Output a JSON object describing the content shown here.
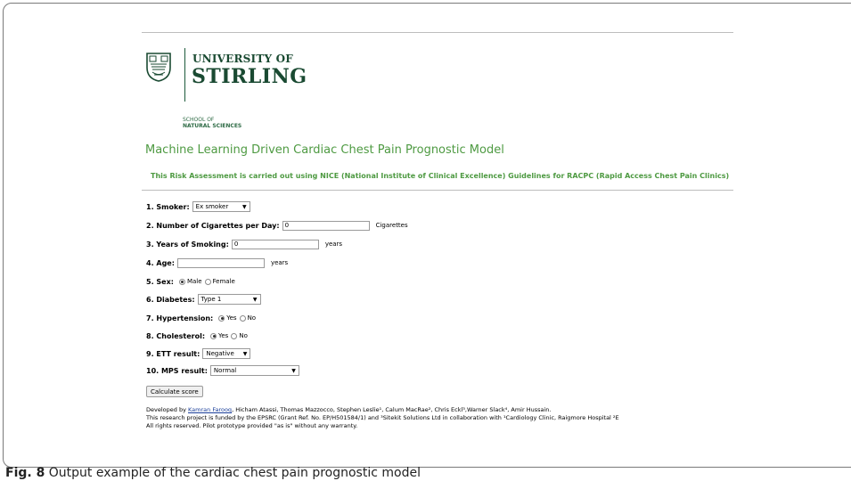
{
  "header": {
    "university_of": "UNIVERSITY OF",
    "university_name": "STIRLING",
    "school_of": "SCHOOL OF",
    "school_name": "NATURAL SCIENCES"
  },
  "app": {
    "title": "Machine Learning Driven Cardiac Chest Pain Prognostic Model",
    "subtitle": "This Risk Assessment is carried out using NICE (National Institute of Clinical Excellence) Guidelines for RACPC (Rapid Access Chest Pain Clinics)"
  },
  "form": {
    "smoker": {
      "label": "1. Smoker:",
      "value": "Ex smoker"
    },
    "cigarettes": {
      "label": "2. Number of Cigarettes per Day:",
      "value": "0",
      "unit": "Cigarettes"
    },
    "years_smoking": {
      "label": "3. Years of Smoking:",
      "value": "0",
      "unit": "years"
    },
    "age": {
      "label": "4. Age:",
      "value": "",
      "unit": "years"
    },
    "sex": {
      "label": "5. Sex:",
      "opt1": "Male",
      "opt2": "Female",
      "selected": "Male"
    },
    "diabetes": {
      "label": "6. Diabetes:",
      "value": "Type 1"
    },
    "hypertension": {
      "label": "7. Hypertension:",
      "opt1": "Yes",
      "opt2": "No",
      "selected": "Yes"
    },
    "cholesterol": {
      "label": "8. Cholesterol:",
      "opt1": "Yes",
      "opt2": "No",
      "selected": "Yes"
    },
    "ett": {
      "label": "9. ETT result:",
      "value": "Negative"
    },
    "mps": {
      "label": "10. MPS result:",
      "value": "Normal"
    },
    "calculate_label": "Calculate score"
  },
  "footer": {
    "developed_by": "Developed by",
    "author_link": "Kamran Farooq",
    "authors_rest": ", Hicham Atassi, Thomas Mazzocco, Stephen Leslie¹, Calum MacRae², Chris Eckl³,Warner Slack⁴, Amir Hussain.",
    "funding": "This research project is funded by the EPSRC (Grant Ref. No. EP/H501584/1) and ³Sitekit Solutions Ltd in collaboration with ¹Cardiology Clinic, Raigmore Hospital ²E",
    "rights": "All rights reserved. Pilot prototype provided \"as is\" without any warranty."
  },
  "caption": {
    "fig": "Fig. 8",
    "text": "Output example of the cardiac chest pain prognostic model"
  }
}
